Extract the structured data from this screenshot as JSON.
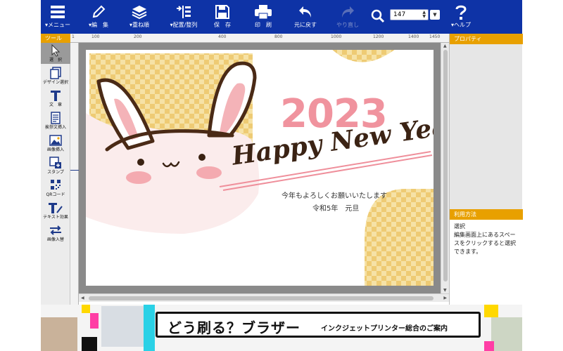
{
  "toolbar": {
    "menu": "▾メニュー",
    "edit": "▾編　集",
    "order": "▾重ね順",
    "arrange": "▾配置/整列",
    "save": "保　存",
    "print": "印　刷",
    "undo": "元に戻す",
    "redo": "やり直し",
    "zoom_value": "147",
    "help": "▾ヘルプ"
  },
  "ruler": {
    "marks": [
      "1",
      "100",
      "200",
      "400",
      "800",
      "1000",
      "1200",
      "1400",
      "1450"
    ]
  },
  "tools": {
    "header": "ツール",
    "items": [
      "選　択",
      "デザイン選択",
      "文　章",
      "挨拶文挿入",
      "画像挿入",
      "スタンプ",
      "QRコード",
      "テキスト効果",
      "画像入替"
    ]
  },
  "card": {
    "year": "2023",
    "script": "Happy New Year",
    "greeting": "今年もよろしくお願いいたします",
    "date": "令和5年　元旦"
  },
  "panel": {
    "properties_header": "プロパティ",
    "usage_header": "利用方法",
    "usage_title": "選択",
    "usage_text": "編集画面上にあるスペースをクリックすると選択できます。"
  },
  "banner": {
    "logo": "どう刷る？ブラザー",
    "subtitle": "インクジェットプリンター総合のご案内"
  },
  "colors": {
    "toolbar": "#0e33a6",
    "header": "#e8a000",
    "pink": "#f08c9a",
    "checker": "#f2d07a"
  }
}
